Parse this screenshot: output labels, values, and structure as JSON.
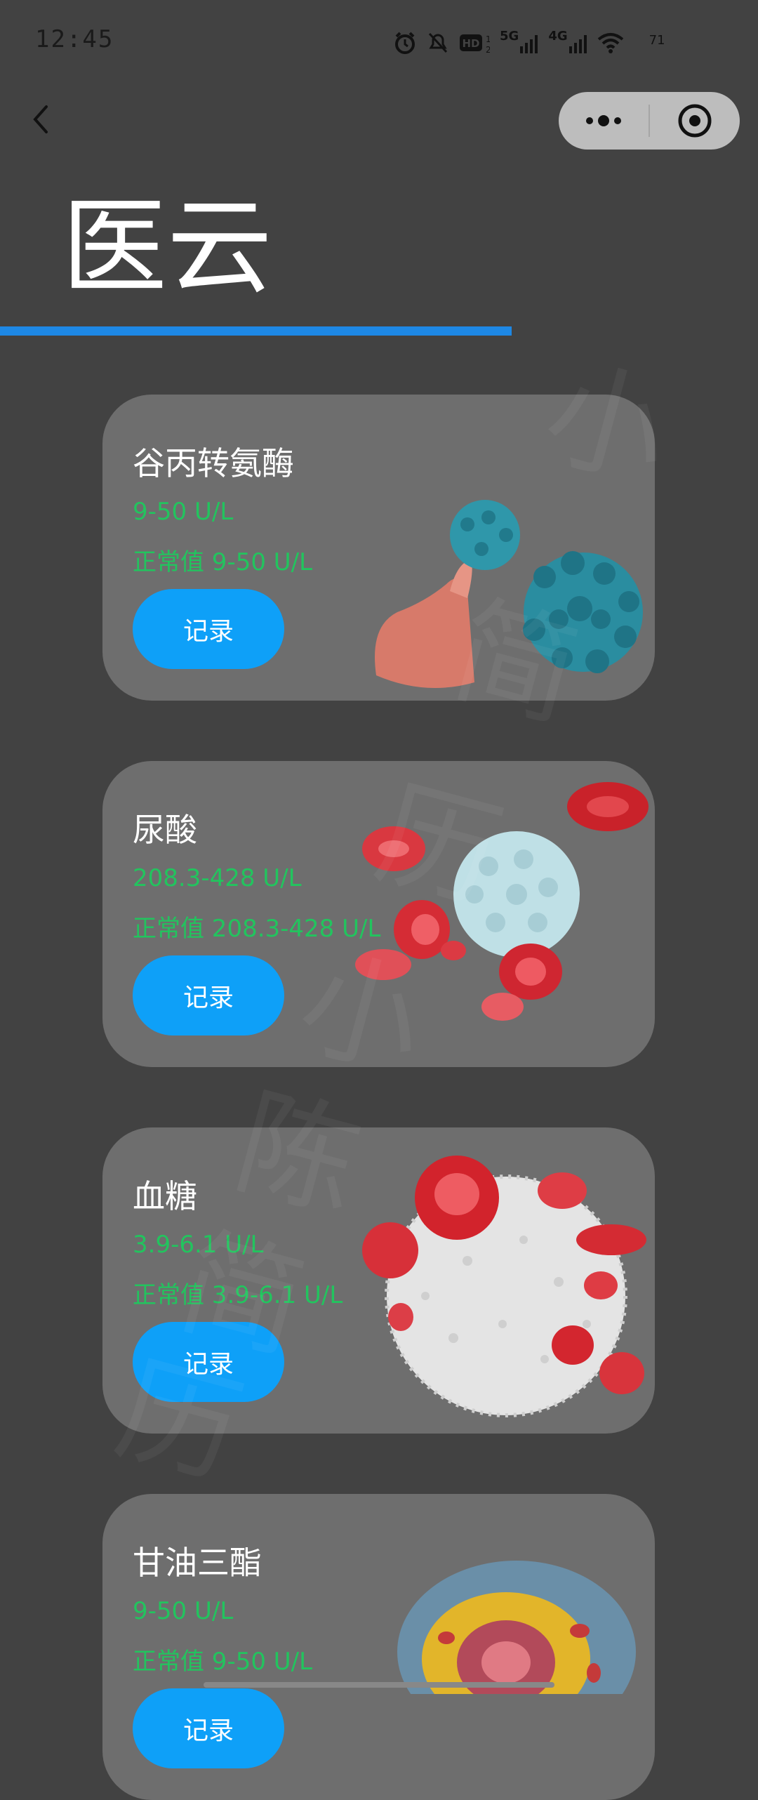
{
  "status_bar": {
    "time": "12:45",
    "net_5g": "5G",
    "net_4g": "4G",
    "battery": "71"
  },
  "header": {
    "title": "医云",
    "back_icon": "chevron-left-icon",
    "more_icon": "more-dots-icon",
    "close_icon": "target-circle-icon"
  },
  "watermark": [
    "小",
    "简",
    "历",
    "小",
    "陈",
    "简",
    "历"
  ],
  "colors": {
    "background": "#424242",
    "card": "#6e6e6e",
    "accent": "#0ea0f8",
    "value_text": "#22c45e",
    "underline": "#1e88e5"
  },
  "cards": [
    {
      "name": "谷丙转氨酶",
      "value": "9-50 U/L",
      "normal": "正常值 9-50 U/L",
      "button": "记录",
      "illustration": "liver-virus-illustration"
    },
    {
      "name": "尿酸",
      "value": "208.3-428 U/L",
      "normal": "正常值 208.3-428 U/L",
      "button": "记录",
      "illustration": "blood-cells-illustration"
    },
    {
      "name": "血糖",
      "value": "3.9-6.1 U/L",
      "normal": "正常值 3.9-6.1 U/L",
      "button": "记录",
      "illustration": "white-cell-illustration"
    },
    {
      "name": "甘油三酯",
      "value": "9-50 U/L",
      "normal": "正常值 9-50 U/L",
      "button": "记录",
      "illustration": "cell-cross-section-illustration"
    }
  ]
}
